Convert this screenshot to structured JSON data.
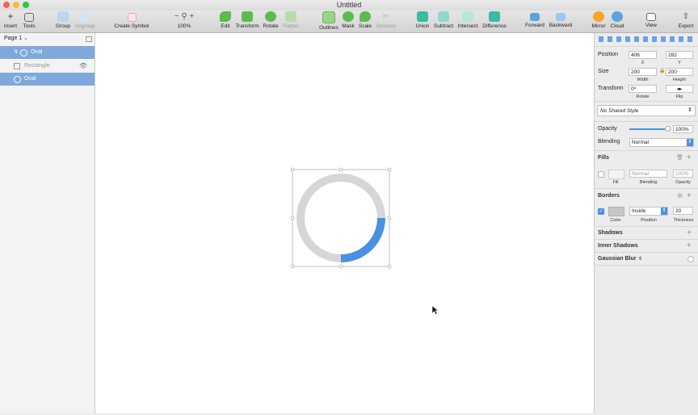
{
  "window": {
    "title": "Untitled"
  },
  "toolbar": {
    "insert": "Insert",
    "tools": "Tools",
    "group": "Group",
    "ungroup": "Ungroup",
    "create_symbol": "Create Symbol",
    "zoom": "100%",
    "edit": "Edit",
    "transform": "Transform",
    "rotate": "Rotate",
    "flatten": "Flatten",
    "outlines": "Outlines",
    "mask": "Mask",
    "scale": "Scale",
    "scissors": "Scissors",
    "union": "Union",
    "subtract": "Subtract",
    "intersect": "Intersect",
    "difference": "Difference",
    "forward": "Forward",
    "backward": "Backward",
    "mirror": "Mirror",
    "cloud": "Cloud",
    "view": "View",
    "export": "Export"
  },
  "layers": {
    "page": "Page 1",
    "items": [
      {
        "name": "Oval",
        "selected": true
      },
      {
        "name": "Rectangle",
        "selected": false
      },
      {
        "name": "Oval",
        "selected": true
      }
    ]
  },
  "inspector": {
    "position_label": "Position",
    "x_value": "406",
    "y_value": "282",
    "x_caption": "X",
    "y_caption": "Y",
    "size_label": "Size",
    "width_value": "200",
    "height_value": "200",
    "width_caption": "Width",
    "height_caption": "Height",
    "transform_label": "Transform",
    "rotate_value": "0º",
    "rotate_caption": "Rotate",
    "flip_caption": "Flip",
    "shared_style": "No Shared Style",
    "opacity_label": "Opacity",
    "opacity_value": "100%",
    "opacity_level": 1.0,
    "blending_label": "Blending",
    "blending_value": "Normal",
    "fills_label": "Fills",
    "fill_blending": "Normal",
    "fill_opacity": "100%",
    "fill_caption": "Fill",
    "fill_blending_caption": "Blending",
    "fill_opacity_caption": "Opacity",
    "borders_label": "Borders",
    "border_position": "Inside",
    "border_thickness": "20",
    "color_caption": "Color",
    "position_caption": "Position",
    "thickness_caption": "Thickness",
    "shadows_label": "Shadows",
    "inner_shadows_label": "Inner Shadows",
    "gaussian_blur_label": "Gaussian Blur"
  },
  "colors": {
    "accent": "#4a90e2",
    "ring_track": "#d6d6d6",
    "ring_progress": "#4a90e2",
    "selection": "#7fa9dc"
  },
  "ring": {
    "progress": 0.25
  }
}
